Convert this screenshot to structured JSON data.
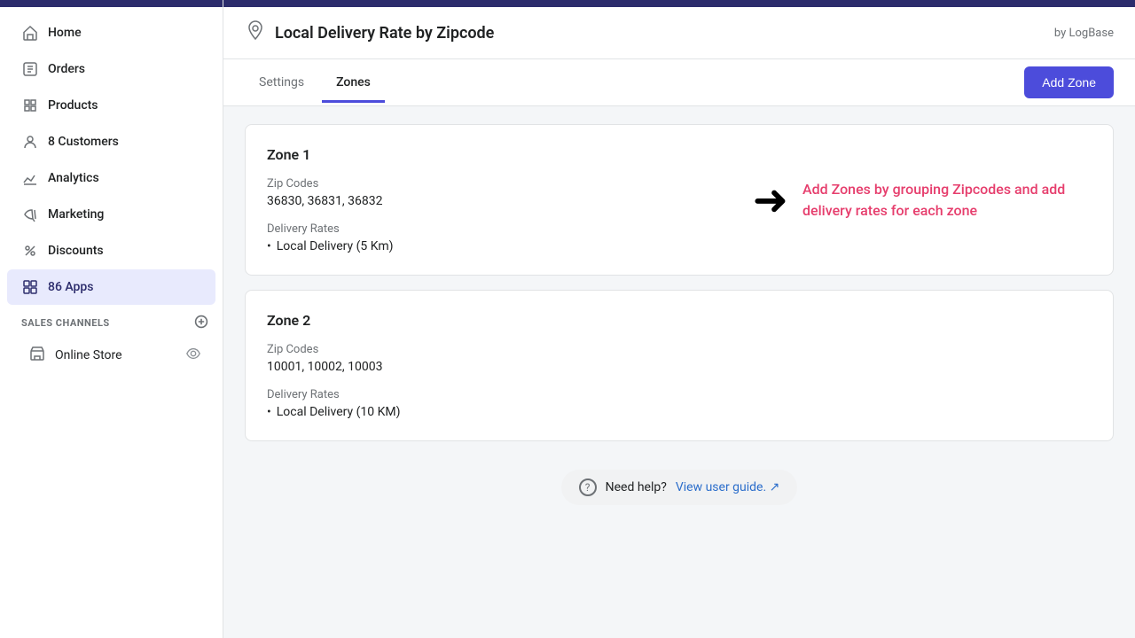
{
  "sidebar": {
    "nav_items": [
      {
        "id": "home",
        "label": "Home",
        "icon": "home",
        "active": false
      },
      {
        "id": "orders",
        "label": "Orders",
        "icon": "orders",
        "active": false
      },
      {
        "id": "products",
        "label": "Products",
        "icon": "products",
        "active": false
      },
      {
        "id": "customers",
        "label": "8 Customers",
        "icon": "customers",
        "active": false
      },
      {
        "id": "analytics",
        "label": "Analytics",
        "icon": "analytics",
        "active": false
      },
      {
        "id": "marketing",
        "label": "Marketing",
        "icon": "marketing",
        "active": false
      },
      {
        "id": "discounts",
        "label": "Discounts",
        "icon": "discounts",
        "active": false
      },
      {
        "id": "apps",
        "label": "86 Apps",
        "icon": "apps",
        "active": true
      }
    ],
    "sales_channels_label": "SALES CHANNELS",
    "online_store_label": "Online Store"
  },
  "header": {
    "app_icon": "📍",
    "title": "Local Delivery Rate by Zipcode",
    "brand": "by LogBase"
  },
  "tabs": [
    {
      "id": "settings",
      "label": "Settings",
      "active": false
    },
    {
      "id": "zones",
      "label": "Zones",
      "active": true
    }
  ],
  "add_zone_btn": "Add Zone",
  "zones": [
    {
      "id": "zone1",
      "title": "Zone 1",
      "zip_codes_label": "Zip Codes",
      "zip_codes": "36830, 36831, 36832",
      "delivery_rates_label": "Delivery Rates",
      "delivery_rates": [
        "Local Delivery (5 Km)"
      ]
    },
    {
      "id": "zone2",
      "title": "Zone 2",
      "zip_codes_label": "Zip Codes",
      "zip_codes": "10001, 10002, 10003",
      "delivery_rates_label": "Delivery Rates",
      "delivery_rates": [
        "Local Delivery (10 KM)"
      ]
    }
  ],
  "annotation": {
    "text": "Add Zones by grouping Zipcodes and add delivery rates for each zone"
  },
  "help": {
    "text": "Need help?",
    "link_label": "View user guide. ↗"
  }
}
